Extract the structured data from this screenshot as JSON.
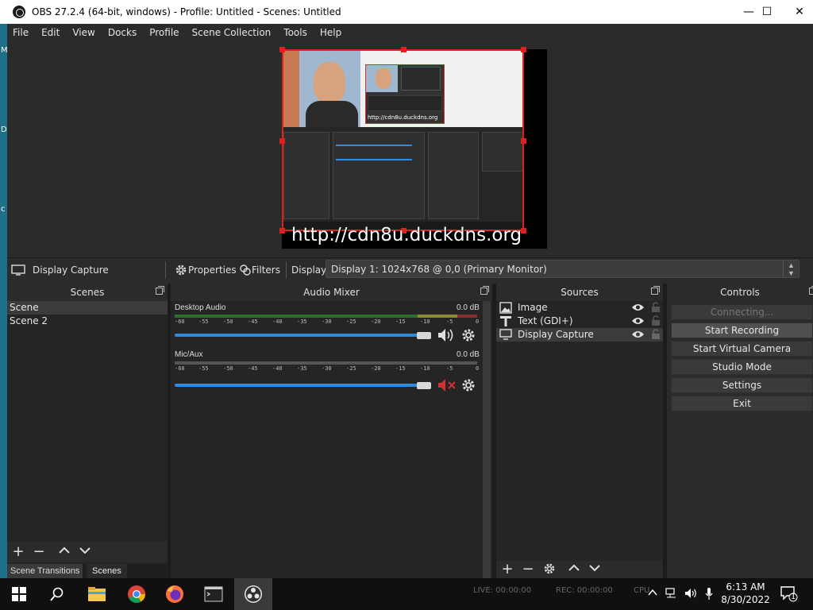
{
  "desktop": {
    "edge_letters": [
      "M",
      "D",
      "c"
    ]
  },
  "window": {
    "title": "OBS 27.2.4 (64-bit, windows) - Profile: Untitled - Scenes: Untitled",
    "minimize": "—",
    "maximize": "☐",
    "close": "✕"
  },
  "menu": [
    "File",
    "Edit",
    "View",
    "Docks",
    "Profile",
    "Scene Collection",
    "Tools",
    "Help"
  ],
  "preview": {
    "overlay_text": "http://cdn8u.duckdns.org",
    "inner_overlay_text": "http://cdn8u.duckdns.org",
    "selection_color": "#e02020"
  },
  "source_toolbar": {
    "source_name": "Display Capture",
    "properties_label": "Properties",
    "filters_label": "Filters",
    "display_label": "Display",
    "display_value": "Display 1: 1024x768 @ 0,0 (Primary Monitor)"
  },
  "scenes": {
    "title": "Scenes",
    "items": [
      "Scene",
      "Scene 2"
    ],
    "selected_index": 0,
    "tabs": [
      "Scene Transitions",
      "Scenes"
    ]
  },
  "audio_mixer": {
    "title": "Audio Mixer",
    "scale_labels": [
      "-60",
      "-55",
      "-50",
      "-45",
      "-40",
      "-35",
      "-30",
      "-25",
      "-20",
      "-15",
      "-10",
      "-5",
      "0"
    ],
    "channels": [
      {
        "name": "Desktop Audio",
        "level": "0.0 dB",
        "muted": false,
        "volume": 1.0
      },
      {
        "name": "Mic/Aux",
        "level": "0.0 dB",
        "muted": true,
        "volume": 1.0
      }
    ]
  },
  "sources": {
    "title": "Sources",
    "items": [
      {
        "name": "Image",
        "icon": "image-icon",
        "visible": true,
        "locked": false
      },
      {
        "name": "Text (GDI+)",
        "icon": "text-icon",
        "visible": true,
        "locked": false
      },
      {
        "name": "Display Capture",
        "icon": "monitor-icon",
        "visible": true,
        "locked": false
      }
    ],
    "selected_index": 2
  },
  "controls": {
    "title": "Controls",
    "buttons": [
      "Connecting...",
      "Start Recording",
      "Start Virtual Camera",
      "Studio Mode",
      "Settings",
      "Exit"
    ]
  },
  "statusbar": {
    "live": "LIVE: 00:00:00",
    "rec": "REC: 00:00:00",
    "cpu": "CPU"
  },
  "taskbar": {
    "time": "6:13 AM",
    "date": "8/30/2022",
    "notification_count": "1",
    "accent": "#2e8be0"
  }
}
